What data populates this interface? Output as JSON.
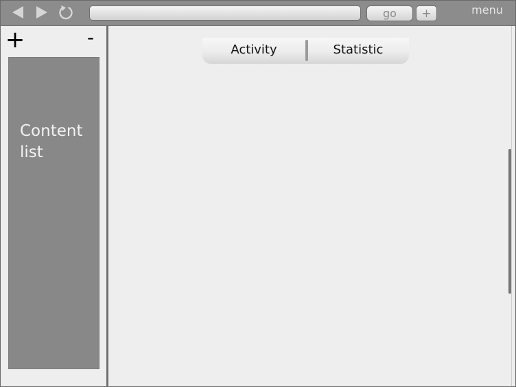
{
  "toolbar": {
    "back_icon": "back-arrow-icon",
    "forward_icon": "forward-arrow-icon",
    "reload_icon": "reload-icon",
    "url_value": "",
    "go_label": "go",
    "new_tab_label": "+",
    "menu_label": "menu"
  },
  "sidebar": {
    "add_label": "+",
    "remove_label": "-",
    "content_list_label": "Content list"
  },
  "main": {
    "tabs": [
      {
        "label": "Activity"
      },
      {
        "label": "Statistic"
      }
    ]
  },
  "colors": {
    "toolbar_bg": "#8c8c8c",
    "window_bg": "#eeeeee",
    "content_list_bg": "#888888",
    "icon_color": "#d8d8d8"
  }
}
